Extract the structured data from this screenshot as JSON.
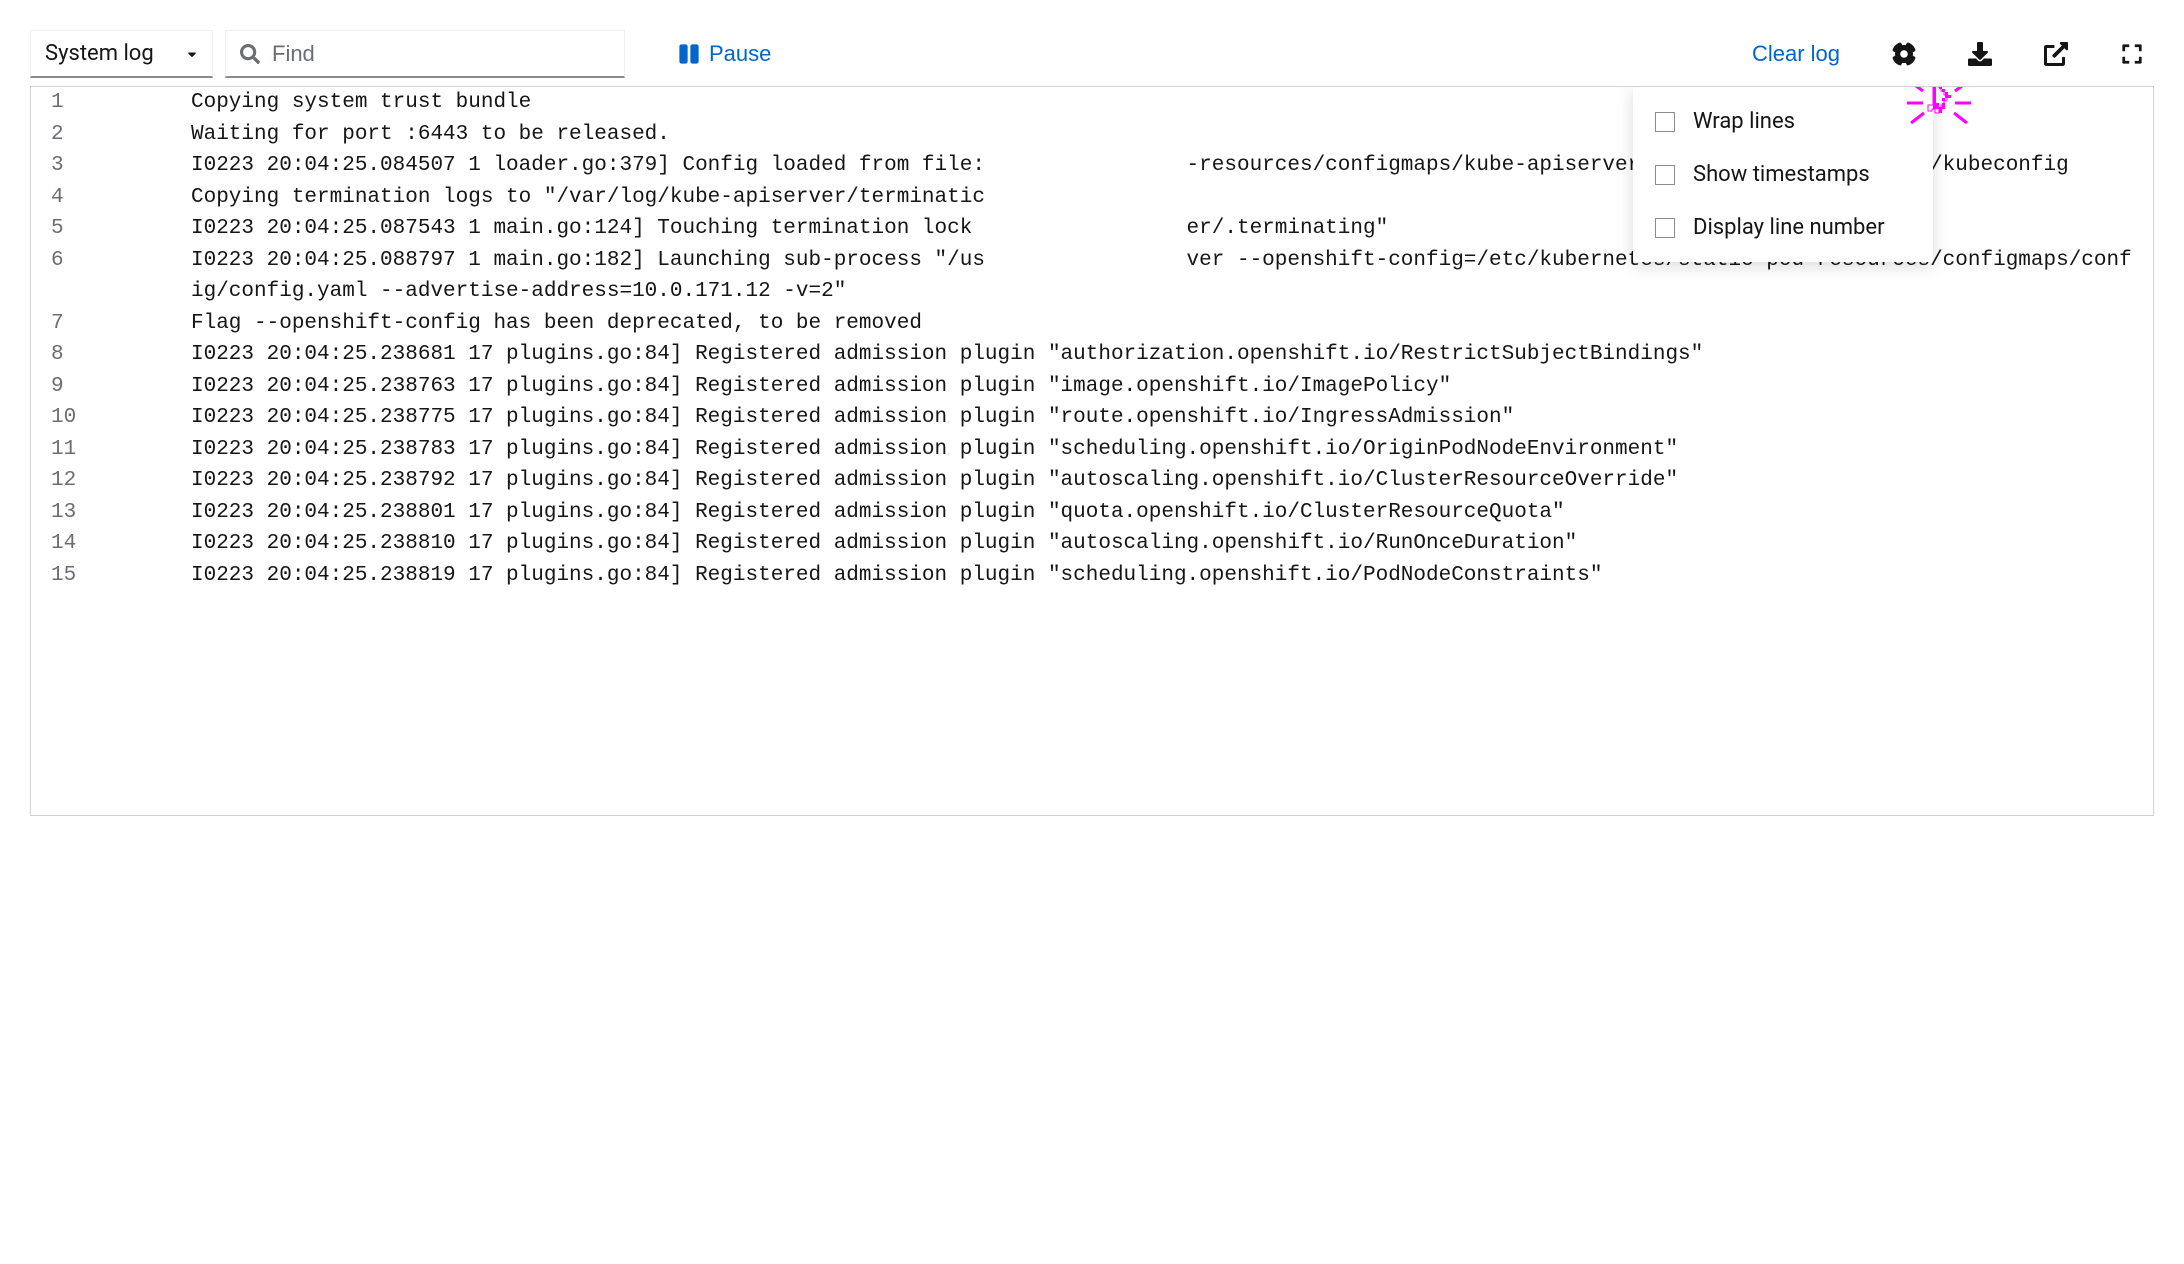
{
  "toolbar": {
    "dropdown_label": "System log",
    "search_placeholder": "Find",
    "pause_label": "Pause",
    "clear_label": "Clear log"
  },
  "settings_menu": {
    "items": [
      {
        "label": "Wrap lines"
      },
      {
        "label": "Show timestamps"
      },
      {
        "label": "Display line number"
      }
    ]
  },
  "log": {
    "lines": [
      {
        "n": "1",
        "text": "Copying system trust bundle"
      },
      {
        "n": "2",
        "text": "Waiting for port :6443 to be released."
      },
      {
        "n": "3",
        "text": "I0223 20:04:25.084507 1 loader.go:379] Config loaded from file:                -resources/configmaps/kube-apiserver-cert-syncer-kubeconfig/kubeconfig"
      },
      {
        "n": "4",
        "text": "Copying termination logs to \"/var/log/kube-apiserver/terminatic"
      },
      {
        "n": "5",
        "text": "I0223 20:04:25.087543 1 main.go:124] Touching termination lock                 er/.terminating\""
      },
      {
        "n": "6",
        "text": "I0223 20:04:25.088797 1 main.go:182] Launching sub-process \"/us                ver --openshift-config=/etc/kubernetes/static-pod-resources/configmaps/config/config.yaml --advertise-address=10.0.171.12 -v=2\""
      },
      {
        "n": "7",
        "text": "Flag --openshift-config has been deprecated, to be removed"
      },
      {
        "n": "8",
        "text": "I0223 20:04:25.238681 17 plugins.go:84] Registered admission plugin \"authorization.openshift.io/RestrictSubjectBindings\""
      },
      {
        "n": "9",
        "text": "I0223 20:04:25.238763 17 plugins.go:84] Registered admission plugin \"image.openshift.io/ImagePolicy\""
      },
      {
        "n": "10",
        "text": "I0223 20:04:25.238775 17 plugins.go:84] Registered admission plugin \"route.openshift.io/IngressAdmission\""
      },
      {
        "n": "11",
        "text": "I0223 20:04:25.238783 17 plugins.go:84] Registered admission plugin \"scheduling.openshift.io/OriginPodNodeEnvironment\""
      },
      {
        "n": "12",
        "text": "I0223 20:04:25.238792 17 plugins.go:84] Registered admission plugin \"autoscaling.openshift.io/ClusterResourceOverride\""
      },
      {
        "n": "13",
        "text": "I0223 20:04:25.238801 17 plugins.go:84] Registered admission plugin \"quota.openshift.io/ClusterResourceQuota\""
      },
      {
        "n": "14",
        "text": "I0223 20:04:25.238810 17 plugins.go:84] Registered admission plugin \"autoscaling.openshift.io/RunOnceDuration\""
      },
      {
        "n": "15",
        "text": "I0223 20:04:25.238819 17 plugins.go:84] Registered admission plugin \"scheduling.openshift.io/PodNodeConstraints\""
      }
    ]
  }
}
